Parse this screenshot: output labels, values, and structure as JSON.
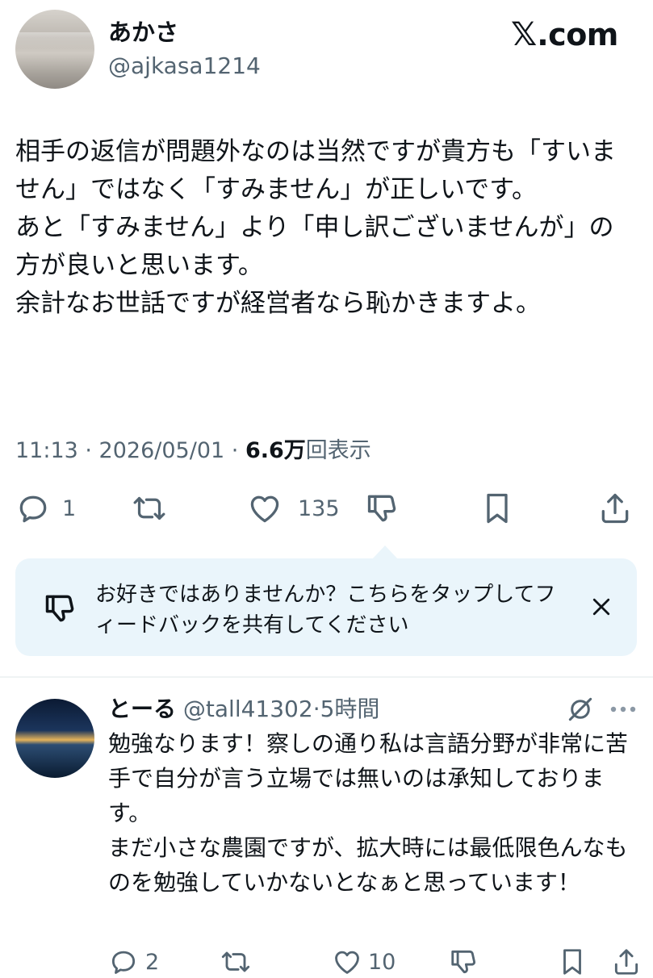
{
  "post": {
    "display_name": "あかさ",
    "handle": "@ajkasa1214",
    "brand": {
      "x": "𝕏",
      "suffix": ".com"
    },
    "body": "相手の返信が問題外なのは当然ですが貴方も「すいません」ではなく「すみません」が正しいです。\nあと「すみません」より「申し訳ございませんが」の方が良いと思います。\n余計なお世話ですが経営者なら恥かきますよ。",
    "time": "11:13 · 2026/05/01 · ",
    "views_count": "6.6万",
    "views_label": "回表示",
    "actions": {
      "reply_count": "1",
      "repost_count": "",
      "like_count": "135"
    }
  },
  "feedback": {
    "text": "お好きではありませんか？こちらをタップしてフィードバックを共有してください"
  },
  "reply": {
    "display_name": "とーる",
    "handle_time": "@tall41302·5時間",
    "body": "勉強なります！察しの通り私は言語分野が非常に苦手で自分が言う立場では無いのは承知しております。\nまだ小さな農園ですが、拡大時には最低限色んなものを勉強していかないとなぁと思っています！",
    "actions": {
      "reply_count": "2",
      "like_count": "10"
    }
  },
  "colors": {
    "text": "#0f1419",
    "secondary": "#536471",
    "feedback_bg": "#eaf5fb",
    "divider": "#eff3f4"
  },
  "icons": [
    "reply-icon",
    "repost-icon",
    "like-icon",
    "dislike-icon",
    "bookmark-icon",
    "share-icon",
    "close-icon",
    "grok-icon",
    "more-icon"
  ]
}
